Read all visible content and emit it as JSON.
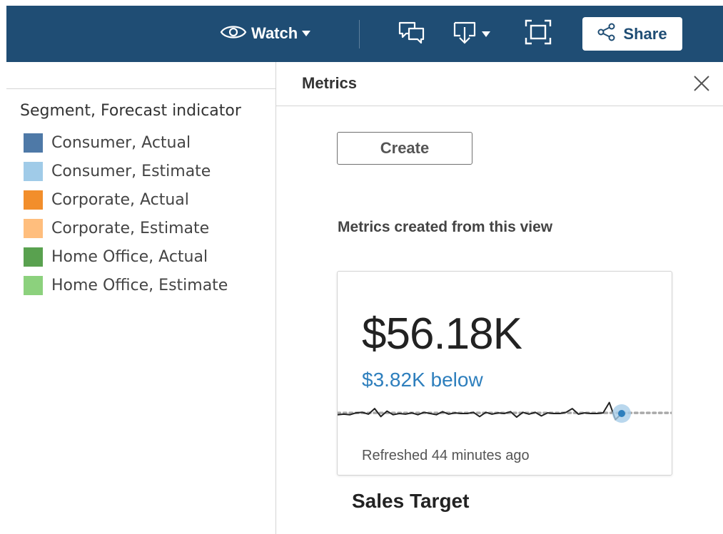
{
  "toolbar": {
    "watch_label": "Watch",
    "share_label": "Share",
    "bar_color": "#1f4d74"
  },
  "legend": {
    "title": "Segment, Forecast indicator",
    "items": [
      {
        "label": "Consumer, Actual",
        "color": "#4e79a7"
      },
      {
        "label": "Consumer, Estimate",
        "color": "#a0cbe8"
      },
      {
        "label": "Corporate, Actual",
        "color": "#f28e2b"
      },
      {
        "label": "Corporate, Estimate",
        "color": "#ffbe7d"
      },
      {
        "label": "Home Office, Actual",
        "color": "#59a14f"
      },
      {
        "label": "Home Office, Estimate",
        "color": "#8cd17d"
      }
    ]
  },
  "metrics_panel": {
    "title": "Metrics",
    "create_label": "Create",
    "section_heading": "Metrics created from this view",
    "card": {
      "value": "$56.18K",
      "comparison": "$3.82K below",
      "refreshed": "Refreshed 44 minutes ago",
      "name": "Sales Target",
      "accent_color": "#2e7fbd"
    }
  },
  "chart_data": {
    "type": "line",
    "title": "",
    "xlabel": "",
    "ylabel": "",
    "series": [
      {
        "values": [
          40,
          41,
          40,
          43,
          44,
          41,
          50,
          37,
          46,
          40,
          42,
          41,
          43,
          40,
          44,
          42,
          40,
          45,
          41,
          43,
          42,
          42,
          44,
          37,
          44,
          41,
          43,
          42,
          45,
          36,
          44,
          41,
          44,
          38,
          43,
          42,
          42,
          44,
          50,
          41,
          43,
          42,
          42,
          43,
          60,
          32,
          42
        ]
      }
    ],
    "target_line": 43,
    "highlighted_index": 46,
    "ylim": [
      0,
      70
    ],
    "grid": false
  }
}
